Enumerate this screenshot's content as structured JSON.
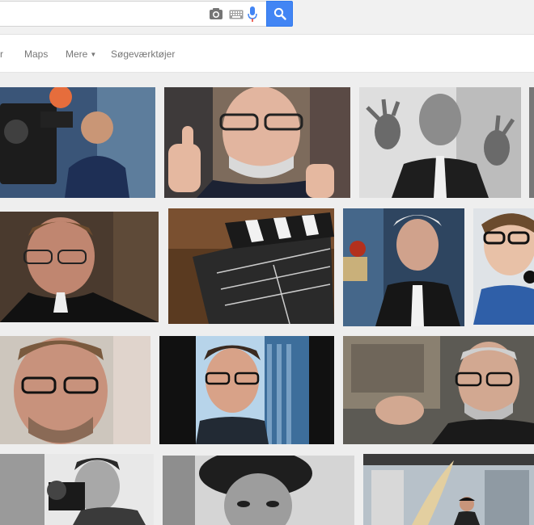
{
  "search": {
    "query": "",
    "placeholder": ""
  },
  "tabs": [
    {
      "label": "r"
    },
    {
      "label": "Maps"
    },
    {
      "label": "Mere"
    },
    {
      "label": "Søgeværktøjer"
    }
  ],
  "icons": {
    "camera": "camera-icon",
    "keyboard": "keyboard-icon",
    "mic": "microphone-icon",
    "search": "magnifier-icon"
  },
  "colors": {
    "search_button": "#4285f4",
    "tab_text": "#777777"
  },
  "images": [
    {
      "row": 1,
      "subject": "cameraman with film camera"
    },
    {
      "row": 1,
      "subject": "smiling man with glasses giving thumbs up"
    },
    {
      "row": 1,
      "subject": "black and white portrait of man gesturing with both hands"
    },
    {
      "row": 1,
      "subject": "cropped image edge"
    },
    {
      "row": 2,
      "subject": "man with glasses in tuxedo"
    },
    {
      "row": 2,
      "subject": "film clapperboard"
    },
    {
      "row": 2,
      "subject": "white-haired man in suit holding award"
    },
    {
      "row": 2,
      "subject": "man with black glasses and headphones"
    },
    {
      "row": 3,
      "subject": "close-up of man with glasses and beard"
    },
    {
      "row": 3,
      "subject": "man with glasses in front of glass building"
    },
    {
      "row": 3,
      "subject": "bearded man with glasses holding object"
    },
    {
      "row": 4,
      "subject": "black and white man with film camera"
    },
    {
      "row": 4,
      "subject": "black and white portrait with curly hair"
    },
    {
      "row": 4,
      "subject": "man next to large tusk in shop"
    }
  ]
}
